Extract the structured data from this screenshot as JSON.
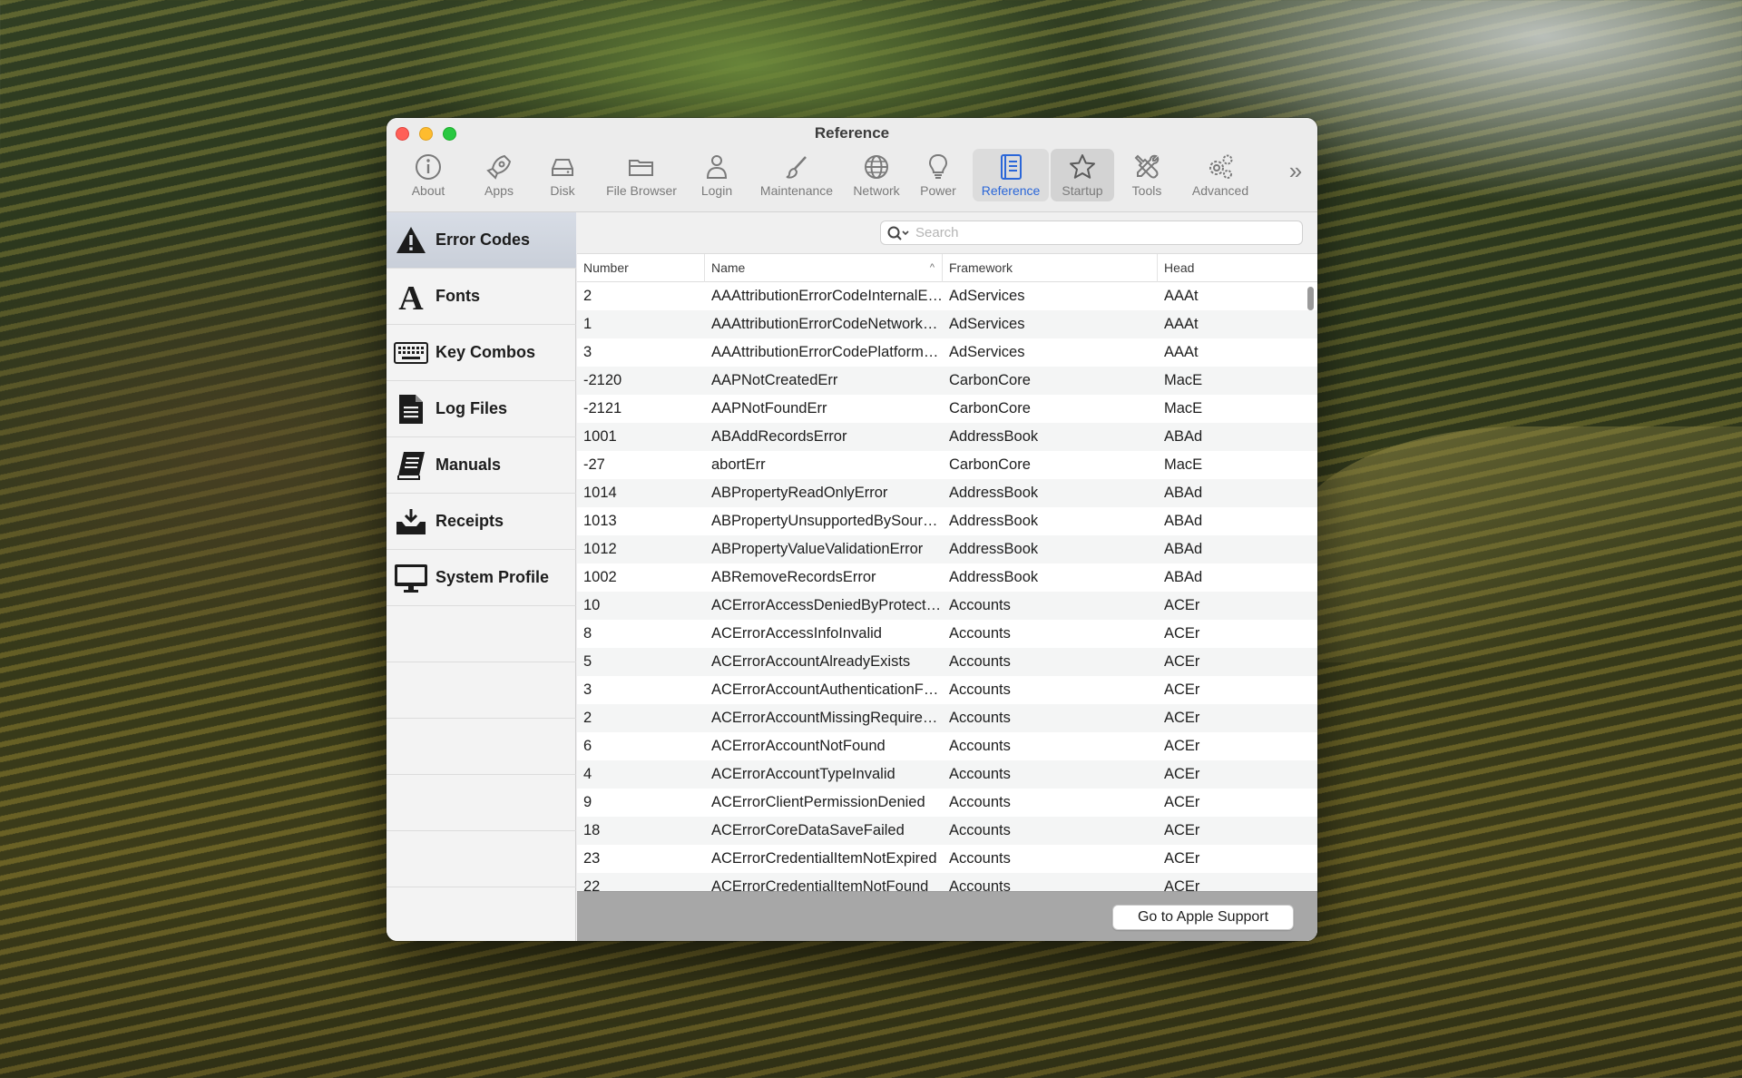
{
  "window": {
    "title": "Reference"
  },
  "toolbar": {
    "items": [
      {
        "label": "About",
        "icon": "info-icon"
      },
      {
        "label": "Apps",
        "icon": "rocket-icon"
      },
      {
        "label": "Disk",
        "icon": "disk-icon"
      },
      {
        "label": "File Browser",
        "icon": "folder-icon"
      },
      {
        "label": "Login",
        "icon": "person-icon"
      },
      {
        "label": "Maintenance",
        "icon": "brush-icon"
      },
      {
        "label": "Network",
        "icon": "globe-icon"
      },
      {
        "label": "Power",
        "icon": "lightbulb-icon"
      },
      {
        "label": "Reference",
        "icon": "book-icon"
      },
      {
        "label": "Startup",
        "icon": "star-icon"
      },
      {
        "label": "Tools",
        "icon": "wrench-screwdriver-icon"
      },
      {
        "label": "Advanced",
        "icon": "gears-icon"
      }
    ],
    "overflow": "»",
    "accent_color": "#2a66d8"
  },
  "sidebar": {
    "items": [
      {
        "label": "Error Codes",
        "icon": "warning-icon",
        "selected": true
      },
      {
        "label": "Fonts",
        "icon": "font-icon"
      },
      {
        "label": "Key Combos",
        "icon": "keyboard-icon"
      },
      {
        "label": "Log Files",
        "icon": "document-icon"
      },
      {
        "label": "Manuals",
        "icon": "manual-icon"
      },
      {
        "label": "Receipts",
        "icon": "inbox-icon"
      },
      {
        "label": "System Profile",
        "icon": "monitor-icon"
      }
    ]
  },
  "search": {
    "placeholder": "Search",
    "value": ""
  },
  "table": {
    "columns": [
      "Number",
      "Name",
      "Framework",
      "Head"
    ],
    "sort_indicator": "^",
    "rows": [
      [
        "2",
        "AAAttributionErrorCodeInternalError",
        "AdServices",
        "AAAt"
      ],
      [
        "1",
        "AAAttributionErrorCodeNetworkError",
        "AdServices",
        "AAAt"
      ],
      [
        "3",
        "AAAttributionErrorCodePlatformNotSu...",
        "AdServices",
        "AAAt"
      ],
      [
        "-2120",
        "AAPNotCreatedErr",
        "CarbonCore",
        "MacE"
      ],
      [
        "-2121",
        "AAPNotFoundErr",
        "CarbonCore",
        "MacE"
      ],
      [
        "1001",
        "ABAddRecordsError",
        "AddressBook",
        "ABAd"
      ],
      [
        "-27",
        "abortErr",
        "CarbonCore",
        "MacE"
      ],
      [
        "1014",
        "ABPropertyReadOnlyError",
        "AddressBook",
        "ABAd"
      ],
      [
        "1013",
        "ABPropertyUnsupportedBySourceError",
        "AddressBook",
        "ABAd"
      ],
      [
        "1012",
        "ABPropertyValueValidationError",
        "AddressBook",
        "ABAd"
      ],
      [
        "1002",
        "ABRemoveRecordsError",
        "AddressBook",
        "ABAd"
      ],
      [
        "10",
        "ACErrorAccessDeniedByProtectionPoli...",
        "Accounts",
        "ACEr"
      ],
      [
        "8",
        "ACErrorAccessInfoInvalid",
        "Accounts",
        "ACEr"
      ],
      [
        "5",
        "ACErrorAccountAlreadyExists",
        "Accounts",
        "ACEr"
      ],
      [
        "3",
        "ACErrorAccountAuthenticationFailed",
        "Accounts",
        "ACEr"
      ],
      [
        "2",
        "ACErrorAccountMissingRequiredPrope...",
        "Accounts",
        "ACEr"
      ],
      [
        "6",
        "ACErrorAccountNotFound",
        "Accounts",
        "ACEr"
      ],
      [
        "4",
        "ACErrorAccountTypeInvalid",
        "Accounts",
        "ACEr"
      ],
      [
        "9",
        "ACErrorClientPermissionDenied",
        "Accounts",
        "ACEr"
      ],
      [
        "18",
        "ACErrorCoreDataSaveFailed",
        "Accounts",
        "ACEr"
      ],
      [
        "23",
        "ACErrorCredentialItemNotExpired",
        "Accounts",
        "ACEr"
      ],
      [
        "22",
        "ACErrorCredentialItemNotFound",
        "Accounts",
        "ACEr"
      ]
    ]
  },
  "footer": {
    "button_label": "Go to Apple Support"
  }
}
